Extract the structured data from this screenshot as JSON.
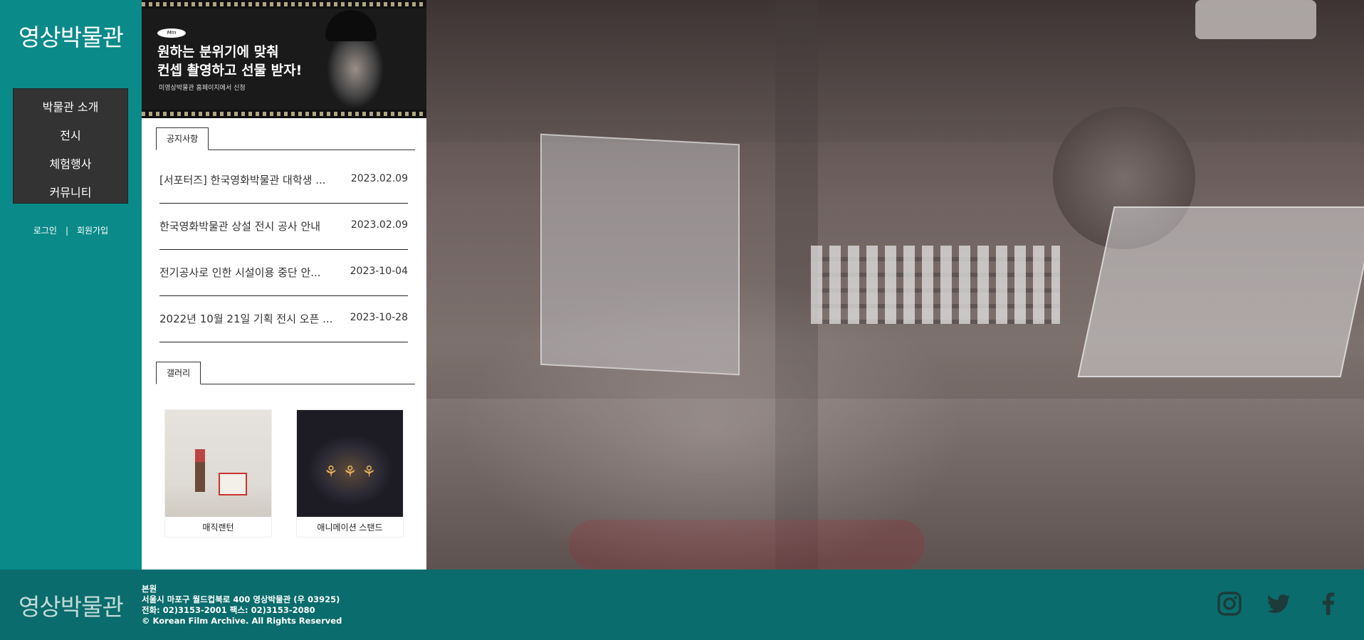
{
  "brand": {
    "logo": "영상박물관"
  },
  "nav": {
    "items": [
      {
        "label": "박물관 소개"
      },
      {
        "label": "전시"
      },
      {
        "label": "체험행사"
      },
      {
        "label": "커뮤니티"
      }
    ]
  },
  "auth": {
    "login": "로그인",
    "separator": "|",
    "signup": "회원가입"
  },
  "banner": {
    "badge": "Mm",
    "title_line1": "원하는 분위기에 맞춰",
    "title_line2": "컨셉 촬영하고 선물 받자!",
    "subtitle": "미영상박물관 홈페이지에서 신청"
  },
  "notice": {
    "tab_label": "공지사항",
    "items": [
      {
        "title": "[서포터즈] 한국영화박물관 대학생 ...",
        "date": "2023.02.09"
      },
      {
        "title": "한국영화박물관 상설 전시 공사 안내",
        "date": "2023.02.09"
      },
      {
        "title": "전기공사로 인한 시설이용 중단 안...",
        "date": "2023-10-04"
      },
      {
        "title": "2022년 10월 21일 기획 전시 오픈 ...",
        "date": "2023-10-28"
      }
    ]
  },
  "gallery": {
    "tab_label": "갤러리",
    "items": [
      {
        "caption": "매직랜턴"
      },
      {
        "caption": "애니메이션 스탠드"
      }
    ]
  },
  "footer": {
    "logo": "영상박물관",
    "branch": "본원",
    "address": "서울시 마포구 월드컵북로 400 영상박물관 (우 03925)",
    "contact": "전화: 02)3153-2001 팩스: 02)3153-2080",
    "copyright": "© Korean Film Archive. All Rights Reserved"
  },
  "social": {
    "icons": [
      "instagram-icon",
      "twitter-icon",
      "facebook-icon"
    ]
  },
  "colors": {
    "brand_teal": "#0b8a8a",
    "footer_teal": "#0a6c6c",
    "nav_bg": "#333333"
  }
}
